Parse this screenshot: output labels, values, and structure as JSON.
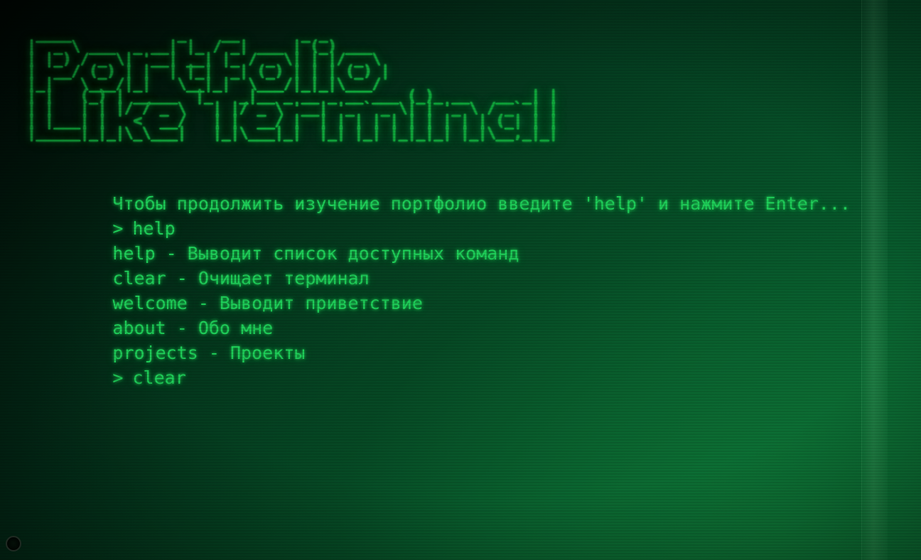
{
  "banner": {
    "ascii_art": " ____            _    __       _ _\n|  _ \\ ___  _ __| |_ / _| ___ | (_) ___\n| |_) / _ \\| '__| __| |_ / _ \\| | |/ _ \\\n|  __/ (_) | |  | |_|  _| (_) | | | (_) |\n|_|   \\___/|_|   \\__|_|  \\___/|_|_|\\___/\n| |   (_) | _____  |_   _|__ _ __ _ __ ___ (_)_ __   __ _| |\n| |   | | |/ / _ \\   | |/ _ \\ '__| '_ ` _ \\| | '_ \\ / _` | |\n| |___| |   <  __/   | |  __/ |  | | | | | | | | | | (_| | |\n|_____|_|_|\\_\\___|   |_|\\___|_|  |_| |_| |_|_|_| |_|\\__,_|_|",
    "title": "Portfolio Like Terminal"
  },
  "terminal": {
    "lines": [
      {
        "type": "info",
        "text": "Чтобы продолжить изучение портфолио введите 'help' и нажмите Enter..."
      },
      {
        "type": "prompt",
        "caret": ">",
        "text": "help"
      },
      {
        "type": "output",
        "text": "help - Выводит список доступных команд"
      },
      {
        "type": "output",
        "text": "clear - Очищает терминал"
      },
      {
        "type": "output",
        "text": "welcome - Выводит приветствие"
      },
      {
        "type": "output",
        "text": "about - Обо мне"
      },
      {
        "type": "output",
        "text": "projects - Проекты"
      },
      {
        "type": "prompt",
        "caret": ">",
        "text": "clear"
      }
    ]
  },
  "colors": {
    "text": "#1fd05a",
    "ascii": "#0fa83c",
    "background_dark": "#000703",
    "background_light": "#0a6b37"
  },
  "icons": {
    "power_button": "power-button-icon"
  }
}
